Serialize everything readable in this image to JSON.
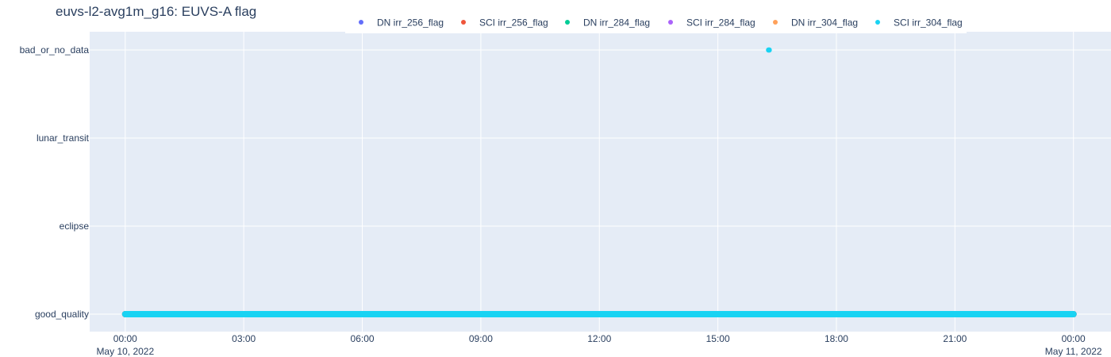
{
  "chart_data": {
    "type": "scatter",
    "title": "euvs-l2-avg1m_g16: EUVS-A flag",
    "x_axis": {
      "type": "date",
      "range": [
        "2022-05-09T23:06:00",
        "2022-05-11T00:57:00"
      ],
      "ticks": [
        {
          "value": "2022-05-10T00:00",
          "label": "00:00",
          "sublabel": "May 10, 2022"
        },
        {
          "value": "2022-05-10T03:00",
          "label": "03:00",
          "sublabel": ""
        },
        {
          "value": "2022-05-10T06:00",
          "label": "06:00",
          "sublabel": ""
        },
        {
          "value": "2022-05-10T09:00",
          "label": "09:00",
          "sublabel": ""
        },
        {
          "value": "2022-05-10T12:00",
          "label": "12:00",
          "sublabel": ""
        },
        {
          "value": "2022-05-10T15:00",
          "label": "15:00",
          "sublabel": ""
        },
        {
          "value": "2022-05-10T18:00",
          "label": "18:00",
          "sublabel": ""
        },
        {
          "value": "2022-05-10T21:00",
          "label": "21:00",
          "sublabel": ""
        },
        {
          "value": "2022-05-11T00:00",
          "label": "00:00",
          "sublabel": "May 11, 2022"
        }
      ]
    },
    "y_axis": {
      "type": "category",
      "categories": [
        "good_quality",
        "eclipse",
        "lunar_transit",
        "bad_or_no_data"
      ]
    },
    "grid": true,
    "legend": {
      "position": "top",
      "orientation": "horizontal"
    },
    "series": [
      {
        "name": "DN irr_256_flag",
        "color": "#636efa",
        "x_range": [
          "2022-05-10T00:00",
          "2022-05-11T00:00"
        ],
        "value": "good_quality",
        "frequency": "1 minute",
        "points": []
      },
      {
        "name": "SCI irr_256_flag",
        "color": "#ef553b",
        "x_range": [
          "2022-05-10T00:00",
          "2022-05-11T00:00"
        ],
        "value": "good_quality",
        "frequency": "1 minute",
        "points": []
      },
      {
        "name": "DN irr_284_flag",
        "color": "#00cc96",
        "x_range": [
          "2022-05-10T00:00",
          "2022-05-11T00:00"
        ],
        "value": "good_quality",
        "frequency": "1 minute",
        "points": []
      },
      {
        "name": "SCI irr_284_flag",
        "color": "#ab63fa",
        "x_range": [
          "2022-05-10T00:00",
          "2022-05-11T00:00"
        ],
        "value": "good_quality",
        "frequency": "1 minute",
        "points": []
      },
      {
        "name": "DN irr_304_flag",
        "color": "#ffa15a",
        "x_range": [
          "2022-05-10T00:00",
          "2022-05-11T00:00"
        ],
        "value": "good_quality",
        "frequency": "1 minute",
        "points": []
      },
      {
        "name": "SCI irr_304_flag",
        "color": "#19d3f3",
        "x_range": [
          "2022-05-10T00:00",
          "2022-05-11T00:00"
        ],
        "value": "good_quality",
        "frequency": "1 minute",
        "points": [
          {
            "x": "2022-05-10T16:17",
            "y": "bad_or_no_data"
          },
          {
            "x": "2022-05-10T16:18",
            "y": "bad_or_no_data"
          }
        ]
      }
    ]
  },
  "colors": {
    "plot_bg": "#e5ecf6",
    "grid": "#ffffff",
    "text": "#2a3f5f"
  }
}
